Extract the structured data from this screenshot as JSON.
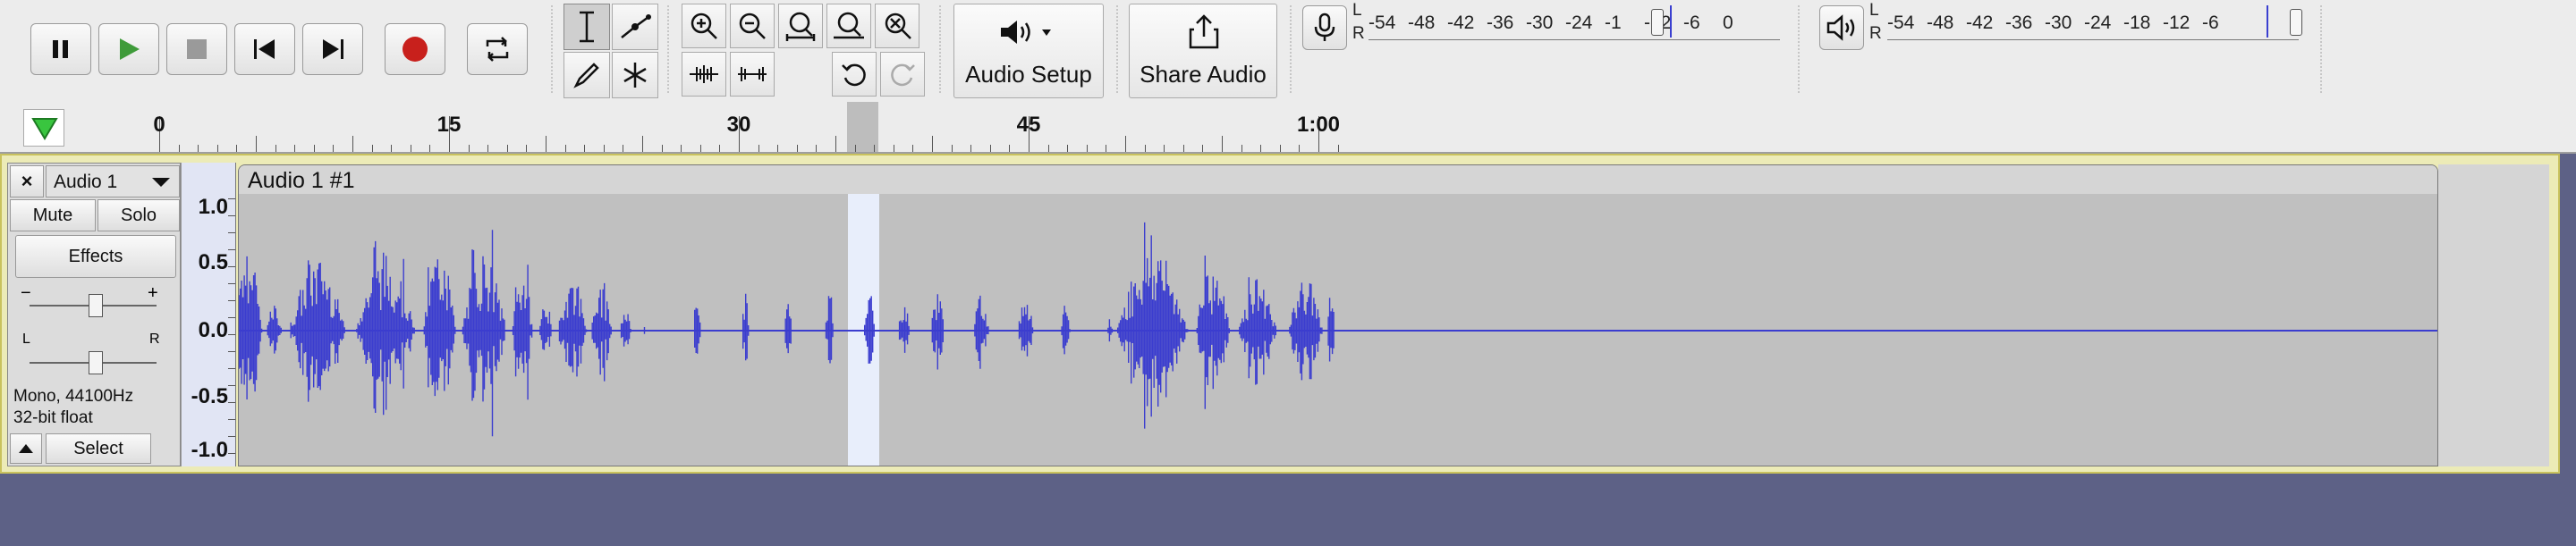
{
  "transport": {
    "buttons": [
      {
        "name": "pause-button",
        "icon": "pause-icon"
      },
      {
        "name": "play-button",
        "icon": "play-icon",
        "color": "#3f9b3a"
      },
      {
        "name": "stop-button",
        "icon": "stop-icon"
      },
      {
        "name": "skip-to-start-button",
        "icon": "skip-start-icon"
      },
      {
        "name": "skip-to-end-button",
        "icon": "skip-end-icon"
      },
      {
        "name": "record-button",
        "icon": "record-icon",
        "color": "#c8201c"
      },
      {
        "name": "loop-button",
        "icon": "loop-icon"
      }
    ]
  },
  "tools": {
    "items": [
      {
        "name": "selection-tool",
        "icon": "i-beam-icon",
        "active": true
      },
      {
        "name": "envelope-tool",
        "icon": "envelope-icon",
        "active": false
      },
      {
        "name": "draw-tool",
        "icon": "pencil-icon",
        "active": false
      },
      {
        "name": "multi-tool",
        "icon": "asterisk-icon",
        "active": false
      }
    ]
  },
  "edit": {
    "items": [
      "zoom-in-icon",
      "zoom-out-icon",
      "fit-selection-icon",
      "fit-project-icon",
      "zoom-toggle-icon",
      "trim-outside-icon",
      "silence-selection-icon",
      "undo-icon",
      "redo-icon"
    ]
  },
  "audio_setup": {
    "label": "Audio Setup",
    "icon": "speaker-icon"
  },
  "share_audio": {
    "label": "Share Audio",
    "icon": "share-icon"
  },
  "record_meter": {
    "icon": "microphone-icon",
    "scale": [
      "-54",
      "-48",
      "-42",
      "-36",
      "-30",
      "-24",
      "-1",
      "-12",
      "-6",
      "0"
    ],
    "left_label": "L",
    "right_label": "R"
  },
  "playback_meter": {
    "icon": "speaker-meter-icon",
    "scale": [
      "-54",
      "-48",
      "-42",
      "-36",
      "-30",
      "-24",
      "-18",
      "-12",
      "-6"
    ],
    "left_label": "L",
    "right_label": "R"
  },
  "timeline": {
    "labels": [
      {
        "text": "0",
        "seconds": 0
      },
      {
        "text": "15",
        "seconds": 15
      },
      {
        "text": "30",
        "seconds": 30
      },
      {
        "text": "45",
        "seconds": 45
      },
      {
        "text": "1:00",
        "seconds": 60
      }
    ],
    "selection_start_seconds": 35.6,
    "selection_end_seconds": 37.2,
    "play_head_icon": "play-head-triangle-icon"
  },
  "track": {
    "name": "Audio 1",
    "mute_label": "Mute",
    "solo_label": "Solo",
    "effects_label": "Effects",
    "gain_minus": "−",
    "gain_plus": "+",
    "pan_left": "L",
    "pan_right": "R",
    "format_line1": "Mono, 44100Hz",
    "format_line2": "32-bit float",
    "select_label": "Select",
    "clip_name": "Audio 1 #1",
    "amplitude_labels": [
      "1.0",
      "0.5",
      "0.0",
      "-0.5",
      "-1.0"
    ],
    "waveform_color": "#3b3dcf",
    "selection_color": "#e8eefb"
  }
}
